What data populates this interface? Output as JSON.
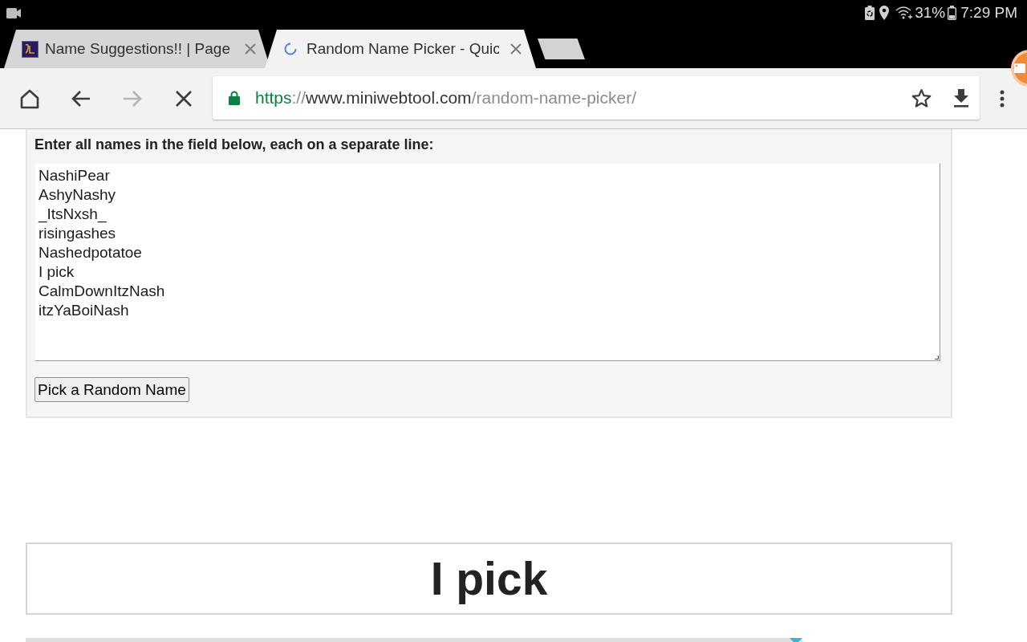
{
  "status_bar": {
    "battery": "31%",
    "time": "7:29 PM"
  },
  "tabs": [
    {
      "title": "Name Suggestions!! | Page",
      "selected": false,
      "loading": false
    },
    {
      "title": "Random Name Picker - Quic",
      "selected": true,
      "loading": true
    }
  ],
  "toolbar": {
    "forward_button": {
      "disabled": true
    },
    "loading": true
  },
  "address_bar": {
    "secure": true,
    "scheme": "https",
    "separator": "://",
    "host": "www.miniwebtool.com",
    "path": "/random-name-picker/"
  },
  "form": {
    "label": "Enter all names in the field below, each on a separate line:",
    "names_field": {
      "value": "NashiPear\nAshyNashy\n_ItsNxsh_\nrisingashes\nNashedpotatoe\nI pick\nCalmDownItzNash\nitzYaBoiNash"
    },
    "button": "Pick a Random Name"
  },
  "result": {
    "name": "I pick"
  }
}
